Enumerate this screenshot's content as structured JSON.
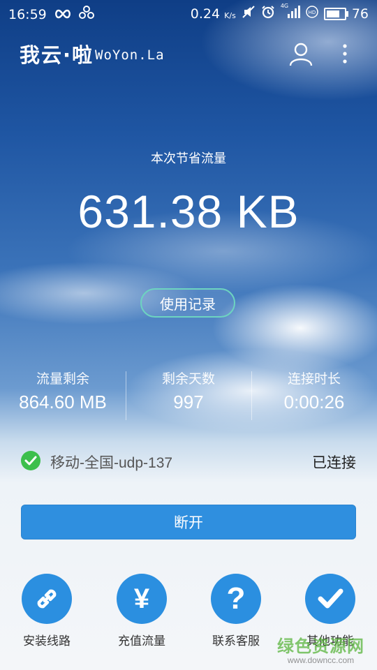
{
  "status_bar": {
    "time": "16:59",
    "net_speed": "0.24",
    "net_unit": "K/s",
    "network_type": "4G",
    "battery": "76",
    "battery_level_percent": 76
  },
  "app_bar": {
    "logo_cn": "我云·啦",
    "logo_en": "WoYon.La"
  },
  "savings": {
    "label": "本次节省流量",
    "value": "631.38 KB"
  },
  "record_button": "使用记录",
  "stats": [
    {
      "label": "流量剩余",
      "value": "864.60 MB"
    },
    {
      "label": "剩余天数",
      "value": "997"
    },
    {
      "label": "连接时长",
      "value": "0:00:26"
    }
  ],
  "server": {
    "name": "移动-全国-udp-137",
    "status": "已连接"
  },
  "disconnect_button": "断开",
  "menu": [
    {
      "label": "安装线路",
      "icon": "link-icon"
    },
    {
      "label": "充值流量",
      "icon": "yen-icon"
    },
    {
      "label": "联系客服",
      "icon": "question-icon"
    },
    {
      "label": "其他功能",
      "icon": "checkmark-icon"
    }
  ],
  "colors": {
    "primary_blue": "#2f8fdf",
    "menu_blue": "#2b8fe0",
    "connected_green": "#3cbf4c",
    "record_border": "#6dd4c0"
  },
  "watermark": {
    "line1": "绿色资源网",
    "line2": "www.downcc.com"
  }
}
